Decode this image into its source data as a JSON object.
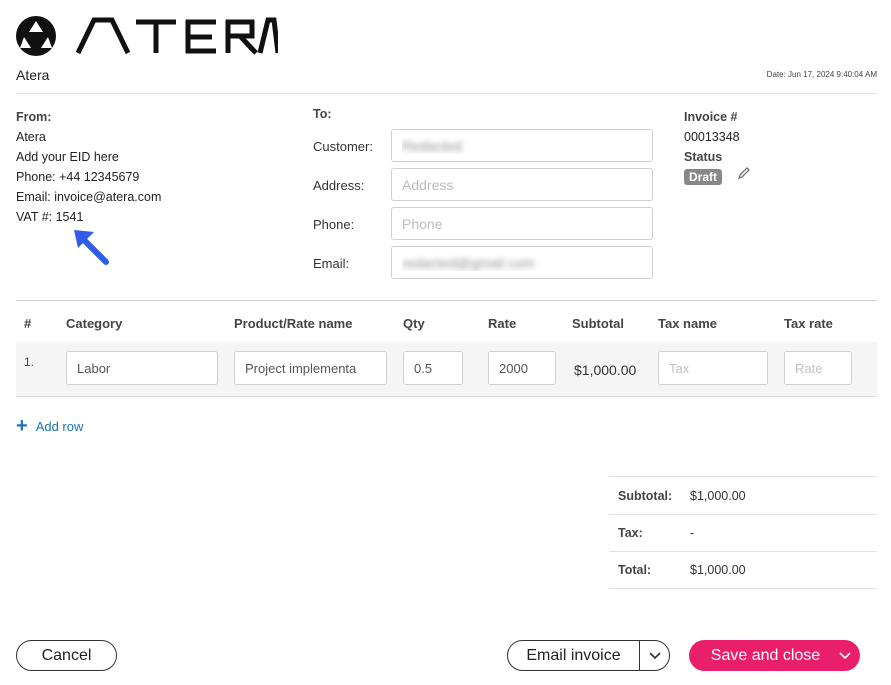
{
  "header": {
    "logo_text": "ATERA",
    "company": "Atera",
    "date_label": "Date:",
    "date_value": "Jun 17, 2024 9:40:04 AM"
  },
  "from": {
    "label": "From:",
    "lines": [
      "Atera",
      "Add your EID here",
      "Phone: +44 12345679",
      "Email: invoice@atera.com",
      "VAT #: 1541"
    ]
  },
  "to": {
    "label": "To:",
    "customer_label": "Customer:",
    "customer_value": "Redacted",
    "address_label": "Address:",
    "address_placeholder": "Address",
    "phone_label": "Phone:",
    "phone_placeholder": "Phone",
    "email_label": "Email:",
    "email_value": "redacted@gmail.com"
  },
  "invoice": {
    "number_label": "Invoice #",
    "number": "00013348",
    "status_label": "Status",
    "status": "Draft"
  },
  "table": {
    "headers": [
      "#",
      "Category",
      "Product/Rate name",
      "Qty",
      "Rate",
      "Subtotal",
      "Tax name",
      "Tax rate"
    ],
    "row": {
      "num": "1.",
      "category": "Labor",
      "product": "Project implementa",
      "qty": "0.5",
      "rate": "2000",
      "subtotal": "$1,000.00",
      "tax_name_placeholder": "Tax",
      "tax_rate_placeholder": "Rate"
    }
  },
  "add_row_label": "Add row",
  "totals": {
    "subtotal_label": "Subtotal:",
    "subtotal": "$1,000.00",
    "tax_label": "Tax:",
    "tax": "-",
    "total_label": "Total:",
    "total": "$1,000.00"
  },
  "buttons": {
    "cancel": "Cancel",
    "email": "Email invoice",
    "save": "Save and close"
  },
  "colors": {
    "accent": "#ea1f6c",
    "link": "#1a73b8",
    "annotation_arrow": "#2f5ce8"
  }
}
